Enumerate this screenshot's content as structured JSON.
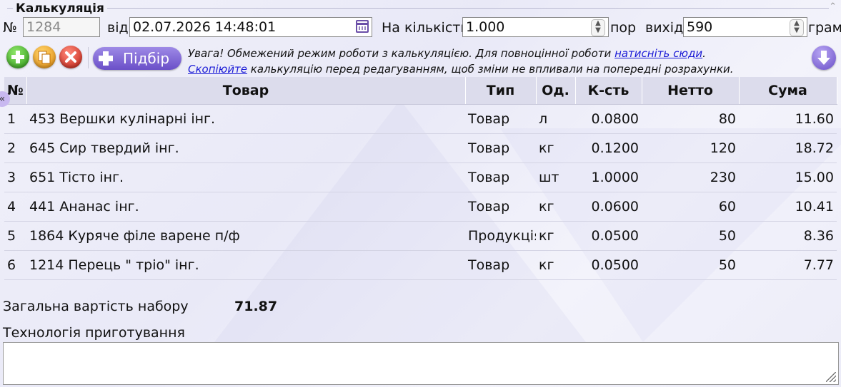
{
  "section_title": "Калькуляція",
  "header": {
    "number_label": "№",
    "number_value": "1284",
    "from_label": "від",
    "date_value": "02.07.2026 14:48:01",
    "quantity_label": "На кількість",
    "quantity_value": "1.000",
    "portion_label": "пор",
    "output_label": "вихід",
    "output_value": "590",
    "gram_label": "грам"
  },
  "toolbar": {
    "pick_label": "Підбір",
    "notice_line1_text": "Увага! Обмежений режим роботи з калькуляцією. Для повноцінної роботи ",
    "notice_line1_link": "натисніть сюди",
    "notice_line1_end": ".",
    "notice_line2_link": "Скопіюйте",
    "notice_line2_text": " калькуляцію перед редагуванням, щоб зміни не впливали на попередні розрахунки."
  },
  "table": {
    "columns": [
      "№",
      "Товар",
      "Тип",
      "Од.",
      "К-сть",
      "Нетто",
      "Сума"
    ],
    "rows": [
      {
        "no": "1",
        "item": "453 Вершки кулінарні інг.",
        "type": "Товар",
        "unit": "л",
        "qty": "0.0800",
        "net": "80",
        "sum": "11.60"
      },
      {
        "no": "2",
        "item": "645 Сир твердий інг.",
        "type": "Товар",
        "unit": "кг",
        "qty": "0.1200",
        "net": "120",
        "sum": "18.72"
      },
      {
        "no": "3",
        "item": "651 Тісто інг.",
        "type": "Товар",
        "unit": "шт",
        "qty": "1.0000",
        "net": "230",
        "sum": "15.00"
      },
      {
        "no": "4",
        "item": "441 Ананас інг.",
        "type": "Товар",
        "unit": "кг",
        "qty": "0.0600",
        "net": "60",
        "sum": "10.41"
      },
      {
        "no": "5",
        "item": "1864 Куряче філе варене п/ф",
        "type": "Продукція",
        "unit": "кг",
        "qty": "0.0500",
        "net": "50",
        "sum": "8.36"
      },
      {
        "no": "6",
        "item": "1214 Перець \" тріо\" інг.",
        "type": "Товар",
        "unit": "кг",
        "qty": "0.0500",
        "net": "50",
        "sum": "7.77"
      }
    ]
  },
  "summary": {
    "total_label": "Загальна вартість набору",
    "total_value": "71.87",
    "tech_label": "Технологія приготування",
    "tech_value": ""
  },
  "icons": {
    "add": "plus-circle-icon",
    "copy": "copy-icon",
    "delete": "close-icon",
    "down": "arrow-down-icon",
    "calendar": "calendar-icon",
    "collapse_side": "chevron-double-left-icon"
  },
  "colors": {
    "accent": "#6a4fc8",
    "link": "#1a1ad6",
    "header_bg": "#dcdcec"
  }
}
